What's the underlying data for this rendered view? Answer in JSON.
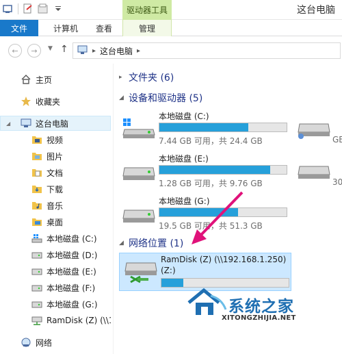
{
  "window": {
    "title": "这台电脑"
  },
  "ribbon": {
    "contextual_header": "驱动器工具",
    "tabs": [
      {
        "label": "文件"
      },
      {
        "label": "计算机"
      },
      {
        "label": "查看"
      },
      {
        "label": "管理"
      }
    ]
  },
  "address": {
    "path": "这台电脑"
  },
  "nav": {
    "items": [
      {
        "label": "主页",
        "icon": "home-icon"
      },
      {
        "label": "收藏夹",
        "icon": "star-icon"
      },
      {
        "label": "这台电脑",
        "icon": "computer-icon"
      },
      {
        "label": "视频",
        "icon": "folder-icon"
      },
      {
        "label": "图片",
        "icon": "folder-icon"
      },
      {
        "label": "文档",
        "icon": "folder-icon"
      },
      {
        "label": "下载",
        "icon": "folder-icon"
      },
      {
        "label": "音乐",
        "icon": "folder-icon"
      },
      {
        "label": "桌面",
        "icon": "folder-icon"
      },
      {
        "label": "本地磁盘 (C:)",
        "icon": "drive-icon"
      },
      {
        "label": "本地磁盘 (D:)",
        "icon": "drive-icon"
      },
      {
        "label": "本地磁盘 (E:)",
        "icon": "drive-icon"
      },
      {
        "label": "本地磁盘 (F:)",
        "icon": "drive-icon"
      },
      {
        "label": "本地磁盘 (G:)",
        "icon": "drive-icon"
      },
      {
        "label": "RamDisk (Z) (\\\\1",
        "icon": "network-drive-icon"
      },
      {
        "label": "网络",
        "icon": "network-icon"
      }
    ]
  },
  "groups": {
    "folders": "文件夹 (6)",
    "devices": "设备和驱动器 (5)",
    "network": "网络位置 (1)"
  },
  "drives": [
    {
      "name": "本地磁盘 (C:)",
      "free": "7.44 GB 可用，共 24.4 GB",
      "used_fraction": 0.7
    },
    {
      "name": "本地磁盘 (E:)",
      "free": "1.28 GB 可用，共 9.76 GB",
      "used_fraction": 0.87
    },
    {
      "name": "本地磁盘 (G:)",
      "free": "19.5 GB 可用，共 51.3 GB",
      "used_fraction": 0.62
    }
  ],
  "partial_drives": [
    {
      "free": "GB"
    },
    {
      "free": "30"
    }
  ],
  "network_drive": {
    "name": "RamDisk (Z) (\\\\192.168.1.250)",
    "name2": "(Z:)",
    "used_fraction": 0.17
  },
  "watermark": {
    "title": "系统之家",
    "subtitle": "XITONGZHIJIA.NET"
  },
  "colors": {
    "accent": "#1979ca",
    "bar_fill": "#26a0da",
    "arrow": "#e0127a"
  }
}
